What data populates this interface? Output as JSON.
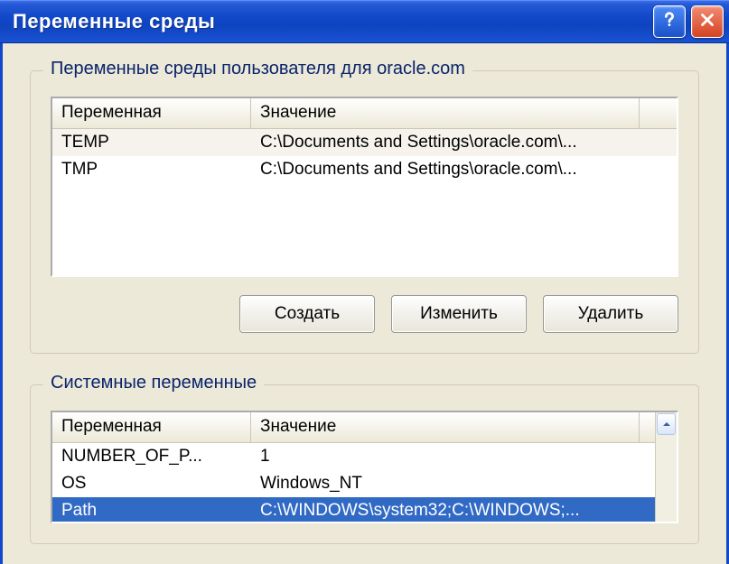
{
  "window": {
    "title": "Переменные среды"
  },
  "user_vars": {
    "legend": "Переменные среды пользователя для oracle.com",
    "columns": {
      "variable": "Переменная",
      "value": "Значение"
    },
    "rows": [
      {
        "variable": "TEMP",
        "value": "C:\\Documents and Settings\\oracle.com\\..."
      },
      {
        "variable": "TMP",
        "value": "C:\\Documents and Settings\\oracle.com\\..."
      }
    ],
    "buttons": {
      "create": "Создать",
      "edit": "Изменить",
      "delete": "Удалить"
    }
  },
  "system_vars": {
    "legend": "Системные переменные",
    "columns": {
      "variable": "Переменная",
      "value": "Значение"
    },
    "rows": [
      {
        "variable": "NUMBER_OF_P...",
        "value": "1"
      },
      {
        "variable": "OS",
        "value": "Windows_NT"
      },
      {
        "variable": "Path",
        "value": "C:\\WINDOWS\\system32;C:\\WINDOWS;..."
      }
    ],
    "selected_index": 2
  }
}
